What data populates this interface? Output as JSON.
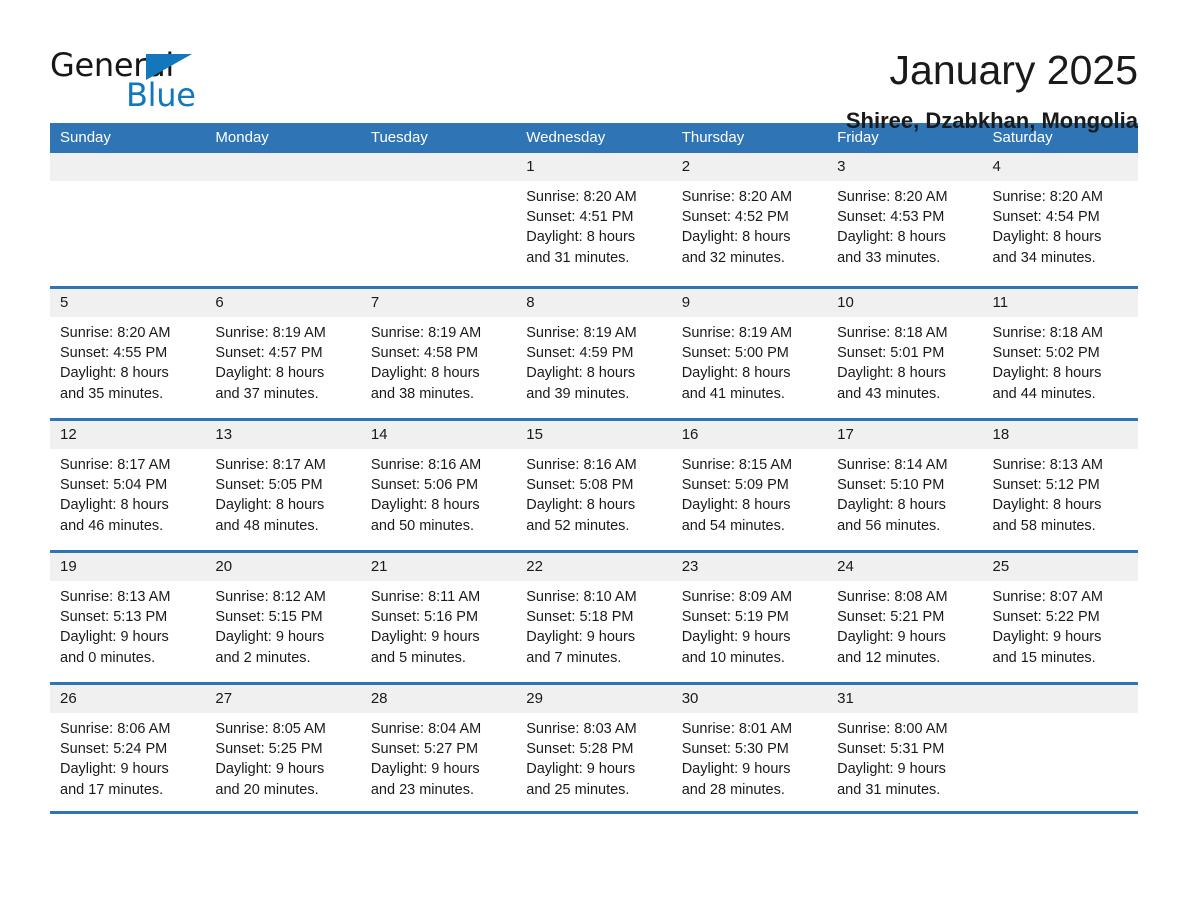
{
  "brand": {
    "name_part1": "General",
    "name_part2": "Blue",
    "logo_icon": "triangle-flag-icon",
    "accent_color": "#1277bc"
  },
  "header": {
    "title": "January 2025",
    "location": "Shiree, Dzabkhan, Mongolia"
  },
  "calendar": {
    "header_color": "#2f75b5",
    "daynum_band_color": "#f0f0f0",
    "weekdays": [
      "Sunday",
      "Monday",
      "Tuesday",
      "Wednesday",
      "Thursday",
      "Friday",
      "Saturday"
    ],
    "weeks": [
      [
        {
          "day": "",
          "lines": []
        },
        {
          "day": "",
          "lines": []
        },
        {
          "day": "",
          "lines": []
        },
        {
          "day": "1",
          "lines": [
            "Sunrise: 8:20 AM",
            "Sunset: 4:51 PM",
            "Daylight: 8 hours",
            "and 31 minutes."
          ]
        },
        {
          "day": "2",
          "lines": [
            "Sunrise: 8:20 AM",
            "Sunset: 4:52 PM",
            "Daylight: 8 hours",
            "and 32 minutes."
          ]
        },
        {
          "day": "3",
          "lines": [
            "Sunrise: 8:20 AM",
            "Sunset: 4:53 PM",
            "Daylight: 8 hours",
            "and 33 minutes."
          ]
        },
        {
          "day": "4",
          "lines": [
            "Sunrise: 8:20 AM",
            "Sunset: 4:54 PM",
            "Daylight: 8 hours",
            "and 34 minutes."
          ]
        }
      ],
      [
        {
          "day": "5",
          "lines": [
            "Sunrise: 8:20 AM",
            "Sunset: 4:55 PM",
            "Daylight: 8 hours",
            "and 35 minutes."
          ]
        },
        {
          "day": "6",
          "lines": [
            "Sunrise: 8:19 AM",
            "Sunset: 4:57 PM",
            "Daylight: 8 hours",
            "and 37 minutes."
          ]
        },
        {
          "day": "7",
          "lines": [
            "Sunrise: 8:19 AM",
            "Sunset: 4:58 PM",
            "Daylight: 8 hours",
            "and 38 minutes."
          ]
        },
        {
          "day": "8",
          "lines": [
            "Sunrise: 8:19 AM",
            "Sunset: 4:59 PM",
            "Daylight: 8 hours",
            "and 39 minutes."
          ]
        },
        {
          "day": "9",
          "lines": [
            "Sunrise: 8:19 AM",
            "Sunset: 5:00 PM",
            "Daylight: 8 hours",
            "and 41 minutes."
          ]
        },
        {
          "day": "10",
          "lines": [
            "Sunrise: 8:18 AM",
            "Sunset: 5:01 PM",
            "Daylight: 8 hours",
            "and 43 minutes."
          ]
        },
        {
          "day": "11",
          "lines": [
            "Sunrise: 8:18 AM",
            "Sunset: 5:02 PM",
            "Daylight: 8 hours",
            "and 44 minutes."
          ]
        }
      ],
      [
        {
          "day": "12",
          "lines": [
            "Sunrise: 8:17 AM",
            "Sunset: 5:04 PM",
            "Daylight: 8 hours",
            "and 46 minutes."
          ]
        },
        {
          "day": "13",
          "lines": [
            "Sunrise: 8:17 AM",
            "Sunset: 5:05 PM",
            "Daylight: 8 hours",
            "and 48 minutes."
          ]
        },
        {
          "day": "14",
          "lines": [
            "Sunrise: 8:16 AM",
            "Sunset: 5:06 PM",
            "Daylight: 8 hours",
            "and 50 minutes."
          ]
        },
        {
          "day": "15",
          "lines": [
            "Sunrise: 8:16 AM",
            "Sunset: 5:08 PM",
            "Daylight: 8 hours",
            "and 52 minutes."
          ]
        },
        {
          "day": "16",
          "lines": [
            "Sunrise: 8:15 AM",
            "Sunset: 5:09 PM",
            "Daylight: 8 hours",
            "and 54 minutes."
          ]
        },
        {
          "day": "17",
          "lines": [
            "Sunrise: 8:14 AM",
            "Sunset: 5:10 PM",
            "Daylight: 8 hours",
            "and 56 minutes."
          ]
        },
        {
          "day": "18",
          "lines": [
            "Sunrise: 8:13 AM",
            "Sunset: 5:12 PM",
            "Daylight: 8 hours",
            "and 58 minutes."
          ]
        }
      ],
      [
        {
          "day": "19",
          "lines": [
            "Sunrise: 8:13 AM",
            "Sunset: 5:13 PM",
            "Daylight: 9 hours",
            "and 0 minutes."
          ]
        },
        {
          "day": "20",
          "lines": [
            "Sunrise: 8:12 AM",
            "Sunset: 5:15 PM",
            "Daylight: 9 hours",
            "and 2 minutes."
          ]
        },
        {
          "day": "21",
          "lines": [
            "Sunrise: 8:11 AM",
            "Sunset: 5:16 PM",
            "Daylight: 9 hours",
            "and 5 minutes."
          ]
        },
        {
          "day": "22",
          "lines": [
            "Sunrise: 8:10 AM",
            "Sunset: 5:18 PM",
            "Daylight: 9 hours",
            "and 7 minutes."
          ]
        },
        {
          "day": "23",
          "lines": [
            "Sunrise: 8:09 AM",
            "Sunset: 5:19 PM",
            "Daylight: 9 hours",
            "and 10 minutes."
          ]
        },
        {
          "day": "24",
          "lines": [
            "Sunrise: 8:08 AM",
            "Sunset: 5:21 PM",
            "Daylight: 9 hours",
            "and 12 minutes."
          ]
        },
        {
          "day": "25",
          "lines": [
            "Sunrise: 8:07 AM",
            "Sunset: 5:22 PM",
            "Daylight: 9 hours",
            "and 15 minutes."
          ]
        }
      ],
      [
        {
          "day": "26",
          "lines": [
            "Sunrise: 8:06 AM",
            "Sunset: 5:24 PM",
            "Daylight: 9 hours",
            "and 17 minutes."
          ]
        },
        {
          "day": "27",
          "lines": [
            "Sunrise: 8:05 AM",
            "Sunset: 5:25 PM",
            "Daylight: 9 hours",
            "and 20 minutes."
          ]
        },
        {
          "day": "28",
          "lines": [
            "Sunrise: 8:04 AM",
            "Sunset: 5:27 PM",
            "Daylight: 9 hours",
            "and 23 minutes."
          ]
        },
        {
          "day": "29",
          "lines": [
            "Sunrise: 8:03 AM",
            "Sunset: 5:28 PM",
            "Daylight: 9 hours",
            "and 25 minutes."
          ]
        },
        {
          "day": "30",
          "lines": [
            "Sunrise: 8:01 AM",
            "Sunset: 5:30 PM",
            "Daylight: 9 hours",
            "and 28 minutes."
          ]
        },
        {
          "day": "31",
          "lines": [
            "Sunrise: 8:00 AM",
            "Sunset: 5:31 PM",
            "Daylight: 9 hours",
            "and 31 minutes."
          ]
        },
        {
          "day": "",
          "lines": []
        }
      ]
    ]
  }
}
